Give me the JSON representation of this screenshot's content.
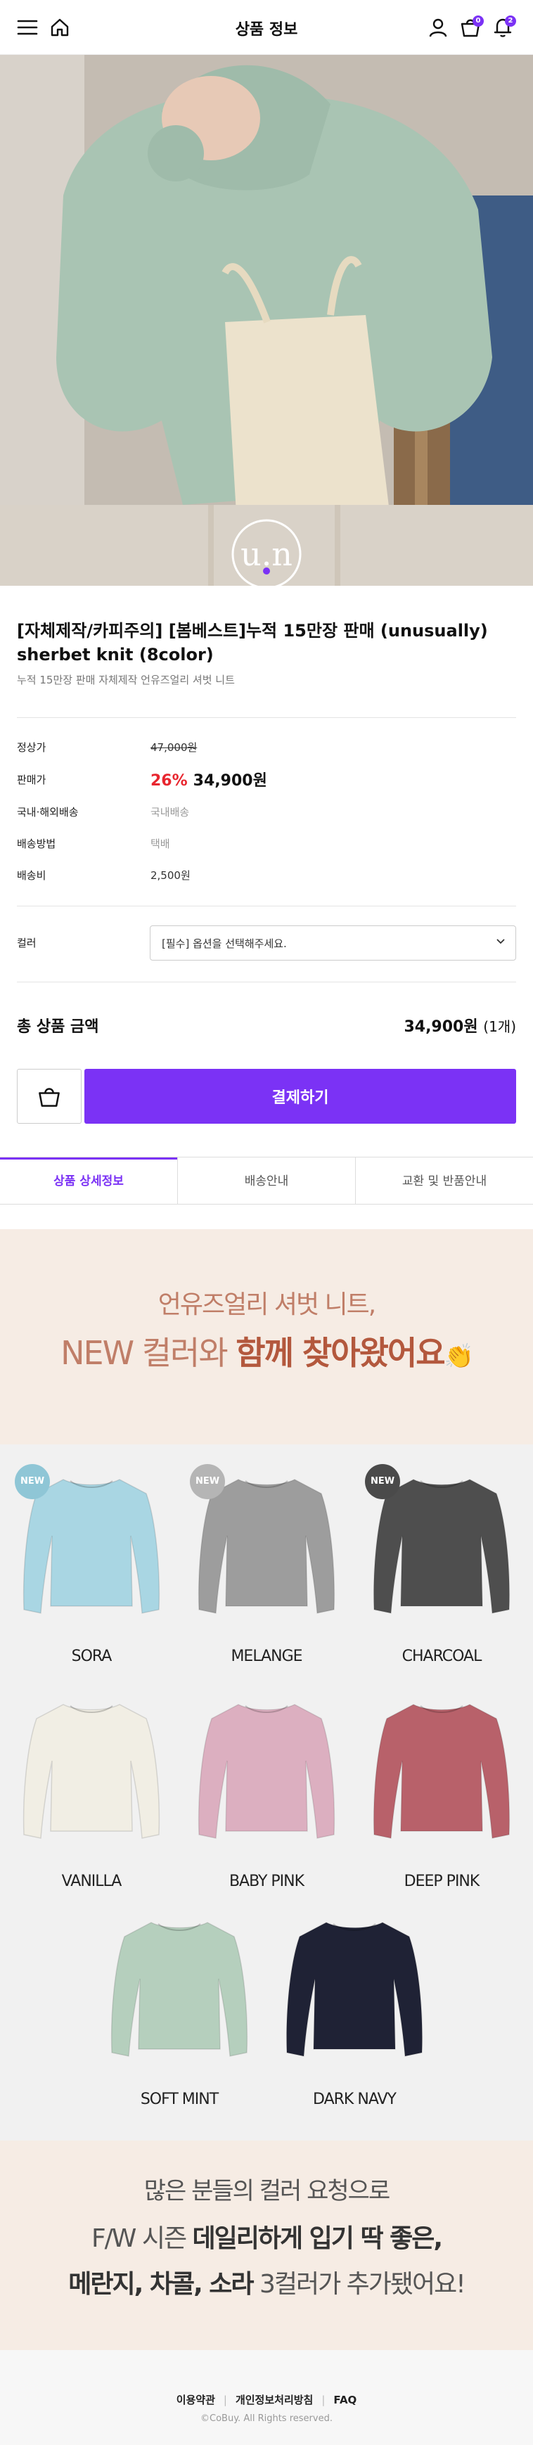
{
  "header": {
    "title": "상품 정보",
    "cart_count": "0",
    "notification_count": "2"
  },
  "hero": {
    "logo_text": "u.n"
  },
  "product": {
    "title": "[자체제작/카피주의] [봄베스트]누적 15만장 판매 (unusually) sherbet knit (8color)",
    "subtitle": "누적 15만장 판매 자체제작 언유즈얼리 셔벗 니트"
  },
  "details": {
    "list_price_label": "정상가",
    "list_price": "47,000원",
    "sale_price_label": "판매가",
    "discount_rate": "26%",
    "sale_price": "34,900원",
    "domestic_label": "국내·해외배송",
    "domestic_value": "국내배송",
    "method_label": "배송방법",
    "method_value": "택배",
    "fee_label": "배송비",
    "fee_value": "2,500원"
  },
  "option": {
    "label": "컬러",
    "placeholder": "[필수] 옵션을 선택해주세요."
  },
  "total": {
    "label": "총 상품 금액",
    "amount": "34,900원",
    "qty": "(1개)"
  },
  "actions": {
    "buy_label": "결제하기"
  },
  "tabs": [
    {
      "label": "상품 상세정보"
    },
    {
      "label": "배송안내"
    },
    {
      "label": "교환 및 반품안내"
    }
  ],
  "promo": {
    "line1": "언유즈얼리 셔벗 니트,",
    "line2_a": "NEW 컬러와 ",
    "line2_b": "함께 찾아왔어요",
    "emoji": "👏"
  },
  "colors": [
    {
      "name": "SORA",
      "hex": "#a9d6e3",
      "new": true,
      "badge_color": "#8fc6d6"
    },
    {
      "name": "MELANGE",
      "hex": "#9d9d9d",
      "new": true,
      "badge_color": "#b5b5b5"
    },
    {
      "name": "CHARCOAL",
      "hex": "#4e4e4e",
      "new": true,
      "badge_color": "#4a4a4a"
    },
    {
      "name": "VANILLA",
      "hex": "#f1eee4",
      "new": false
    },
    {
      "name": "BABY PINK",
      "hex": "#dcafc0",
      "new": false
    },
    {
      "name": "DEEP PINK",
      "hex": "#b8616a",
      "new": false
    },
    {
      "name": "SOFT MINT",
      "hex": "#b5cfbd",
      "new": false
    },
    {
      "name": "DARK NAVY",
      "hex": "#1f2235",
      "new": false
    }
  ],
  "badge_text": "NEW",
  "bottom": {
    "line1": "많은 분들의 컬러 요청으로",
    "line2_a": "F/W 시즌 ",
    "line2_b": "데일리하게 입기 딱 좋은,",
    "line3_a": "메란지, 차콜, 소라",
    "line3_b": " 3컬러가 추가됐어요!"
  },
  "footer": {
    "links": [
      "이용약관",
      "개인정보처리방침",
      "FAQ"
    ],
    "copyright": "©CoBuy. All Rights reserved."
  }
}
